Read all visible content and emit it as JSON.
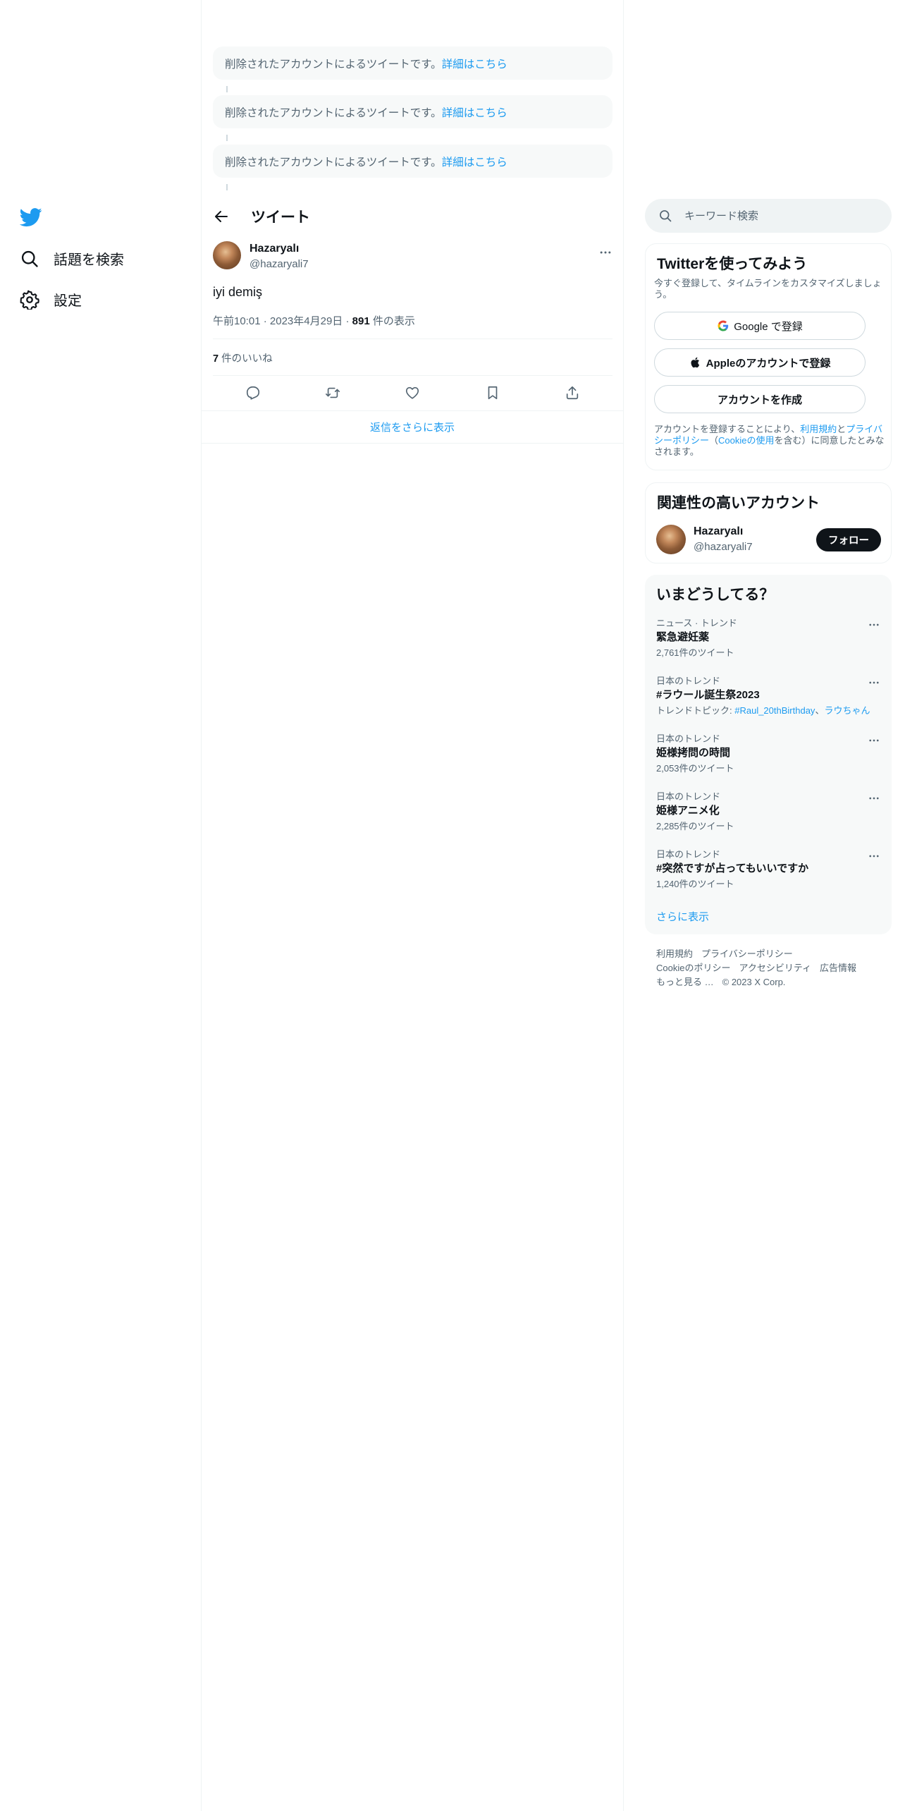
{
  "nav": {
    "explore_label": "話題を検索",
    "settings_label": "設定"
  },
  "deleted_notices": [
    {
      "text": "削除されたアカウントによるツイートです。",
      "link": "詳細はこちら"
    },
    {
      "text": "削除されたアカウントによるツイートです。",
      "link": "詳細はこちら"
    },
    {
      "text": "削除されたアカウントによるツイートです。",
      "link": "詳細はこちら"
    }
  ],
  "tweet": {
    "header_title": "ツイート",
    "author_name": "Hazaryalı",
    "author_handle": "@hazaryali7",
    "text": "iyi demiş",
    "time": "午前10:01",
    "date": "2023年4月29日",
    "views_count": "891",
    "views_label": " 件の表示",
    "likes_count": "7",
    "likes_label": " 件のいいね",
    "show_more_replies": "返信をさらに表示"
  },
  "search": {
    "placeholder": "キーワード検索"
  },
  "signup": {
    "title": "Twitterを使ってみよう",
    "subtitle": "今すぐ登録して、タイムラインをカスタマイズしましょう。",
    "google_label": "Google で登録",
    "apple_label": "Appleのアカウントで登録",
    "create_label": "アカウントを作成",
    "terms_prefix": "アカウントを登録することにより、",
    "terms_link": "利用規約",
    "terms_and": "と",
    "privacy_link": "プライバシーポリシー",
    "terms_paren_open": "（",
    "cookie_link": "Cookieの使用",
    "terms_suffix": "を含む）に同意したとみなされます。"
  },
  "who_to_follow": {
    "title": "関連性の高いアカウント",
    "name": "Hazaryalı",
    "handle": "@hazaryali7",
    "follow_label": "フォロー"
  },
  "trends": {
    "title": "いまどうしてる？",
    "items": [
      {
        "category": "ニュース · トレンド",
        "name": "緊急避妊薬",
        "count": "2,761件のツイート"
      },
      {
        "category": "日本のトレンド",
        "name": "#ラウール誕生祭2023",
        "count_prefix": "トレンドトピック: ",
        "topic1": "#Raul_20thBirthday",
        "sep": "、",
        "topic2": "ラウちゃん"
      },
      {
        "category": "日本のトレンド",
        "name": "姫様拷問の時間",
        "count": "2,053件のツイート"
      },
      {
        "category": "日本のトレンド",
        "name": "姫様アニメ化",
        "count": "2,285件のツイート"
      },
      {
        "category": "日本のトレンド",
        "name": "#突然ですが占ってもいいですか",
        "count": "1,240件のツイート"
      }
    ],
    "show_more": "さらに表示"
  },
  "footer": {
    "links": [
      "利用規約",
      "プライバシーポリシー",
      "Cookieのポリシー",
      "アクセシビリティ",
      "広告情報",
      "もっと見る …"
    ],
    "copyright": "© 2023 X Corp."
  },
  "colors": {
    "accent": "#1d9bf0",
    "text": "#0f1419",
    "secondary": "#536471",
    "border": "#eff3f4",
    "card_bg": "#f7f9f9"
  }
}
